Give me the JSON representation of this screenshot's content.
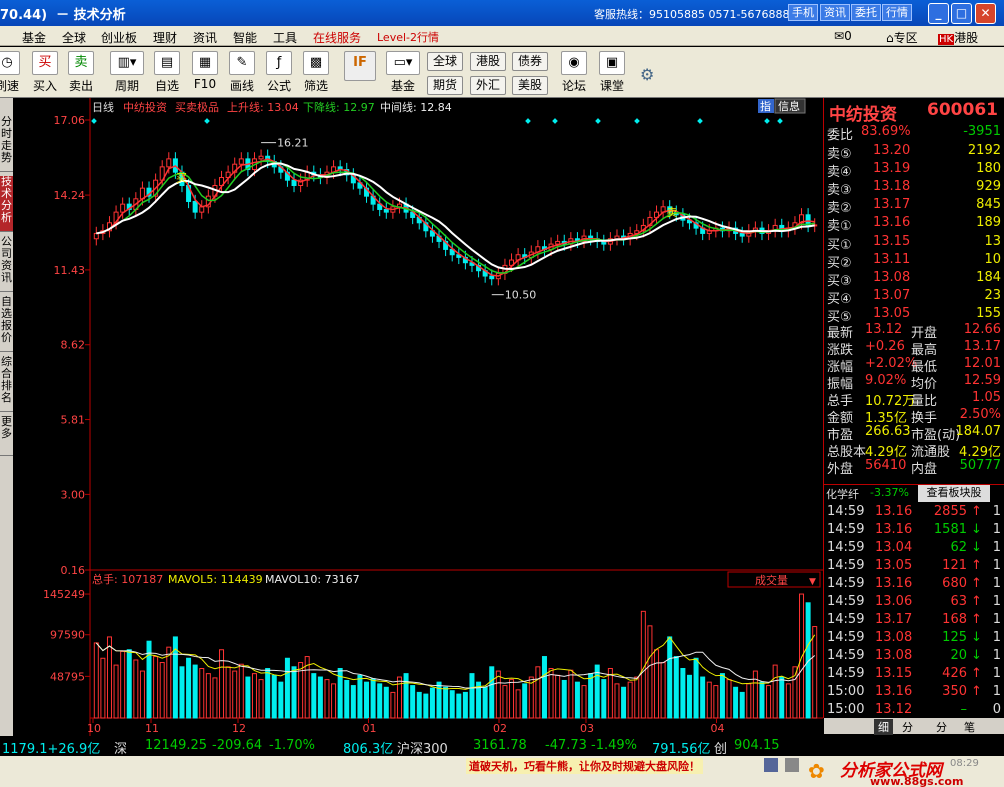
{
  "window": {
    "title": "70.44)  － 技术分析",
    "hotline": "客服热线：95105885  0571-56768888",
    "top_buttons": [
      "手机",
      "资讯",
      "委托",
      "行情"
    ]
  },
  "menu": [
    "基金",
    "全球",
    "创业板",
    "理财",
    "资讯",
    "智能",
    "工具",
    "在线服务",
    "Level-2行情"
  ],
  "menu_right": {
    "mail_count": "0",
    "zone": "专区",
    "hk": "港股"
  },
  "toolbar": {
    "buttons": [
      {
        "label": "刷速",
        "icon": "clock-icon"
      },
      {
        "label": "买入",
        "icon": "buy-icon"
      },
      {
        "label": "卖出",
        "icon": "sell-icon"
      },
      {
        "label": "周期",
        "icon": "period-icon"
      },
      {
        "label": "自选",
        "icon": "watchlist-icon"
      },
      {
        "label": "F10",
        "icon": "f10-icon"
      },
      {
        "label": "画线",
        "icon": "draw-icon"
      },
      {
        "label": "公式",
        "icon": "formula-icon"
      },
      {
        "label": "筛选",
        "icon": "filter-icon"
      },
      {
        "label": "基金",
        "icon": "fund-icon"
      },
      {
        "label": "论坛",
        "icon": "forum-icon"
      },
      {
        "label": "课堂",
        "icon": "class-icon"
      }
    ],
    "small": [
      "全球",
      "港股",
      "债券",
      "期货",
      "外汇",
      "美股"
    ],
    "icon_glyphs": {
      "buy": "买",
      "sell": "卖",
      "if": "IF"
    }
  },
  "left_tabs": [
    "分时走势",
    "技术分析",
    "公司资讯",
    "自选报价",
    "综合排名",
    "更多"
  ],
  "chart_header": {
    "period": "日线",
    "name": "中纺投资",
    "indicator": "买卖极品",
    "upper": "上升线: 13.04",
    "lower": "下降线: 12.97",
    "mid": "中间线: 12.84"
  },
  "chart_overlay": {
    "index_tag": "指",
    "info_tag": "信息",
    "buy_mark": "买",
    "sell_mark": "卖"
  },
  "price_axis": [
    "17.06",
    "14.24",
    "11.43",
    "8.62",
    "5.81",
    "3.00",
    "0.16"
  ],
  "annotations": {
    "high": "16.21",
    "low": "10.50"
  },
  "volume_header": {
    "total": "总手: 107187",
    "ma5": "MAVOL5: 114439",
    "ma10": "MAVOL10: 73167",
    "dropdown": "成交量"
  },
  "volume_axis": [
    "145249",
    "97590",
    "48795"
  ],
  "date_axis": [
    "10",
    "11",
    "12",
    "01",
    "02",
    "03",
    "04"
  ],
  "chart_data": {
    "type": "candlestick",
    "price_ylim": [
      0.16,
      17.06
    ],
    "price_ticks": [
      17.06,
      14.24,
      11.43,
      8.62,
      5.81,
      3.0,
      0.16
    ],
    "high_label": 16.21,
    "low_label": 10.5,
    "closes": [
      12.8,
      12.9,
      13.2,
      13.6,
      13.9,
      13.7,
      14.1,
      14.5,
      14.2,
      14.8,
      15.3,
      15.6,
      15.1,
      14.6,
      14.0,
      13.6,
      13.8,
      14.2,
      14.6,
      14.9,
      15.1,
      15.4,
      15.6,
      15.2,
      15.6,
      15.7,
      15.5,
      15.3,
      15.1,
      14.8,
      14.6,
      14.8,
      15.1,
      15.0,
      14.9,
      15.1,
      15.3,
      15.2,
      15.0,
      14.7,
      14.5,
      14.2,
      13.9,
      13.7,
      13.6,
      13.8,
      13.9,
      13.6,
      13.4,
      13.2,
      12.9,
      12.7,
      12.5,
      12.2,
      12.0,
      11.9,
      11.7,
      11.6,
      11.4,
      11.2,
      11.1,
      11.3,
      11.6,
      11.8,
      12.0,
      11.9,
      12.1,
      12.3,
      12.2,
      12.4,
      12.5,
      12.4,
      12.6,
      12.5,
      12.7,
      12.6,
      12.5,
      12.4,
      12.6,
      12.7,
      12.6,
      12.8,
      12.9,
      13.1,
      13.4,
      13.6,
      13.8,
      13.6,
      13.5,
      13.3,
      13.2,
      13.0,
      12.8,
      12.9,
      13.0,
      12.9,
      13.0,
      12.8,
      12.7,
      12.9,
      13.0,
      12.8,
      12.9,
      13.1,
      12.9,
      13.0,
      13.2,
      13.5,
      13.1,
      13.12
    ],
    "volumes": [
      88000,
      70000,
      95000,
      62000,
      78000,
      80000,
      68000,
      55000,
      90000,
      72000,
      65000,
      83000,
      95000,
      60000,
      70000,
      62000,
      58000,
      52000,
      47000,
      80000,
      60000,
      55000,
      63000,
      48000,
      52000,
      45000,
      58000,
      50000,
      42000,
      70000,
      60000,
      65000,
      72000,
      52000,
      48000,
      45000,
      40000,
      58000,
      44000,
      38000,
      50000,
      42000,
      46000,
      40000,
      36000,
      30000,
      48000,
      52000,
      38000,
      30000,
      28000,
      35000,
      42000,
      36000,
      32000,
      28000,
      30000,
      52000,
      42000,
      36000,
      60000,
      55000,
      38000,
      45000,
      33000,
      40000,
      48000,
      60000,
      72000,
      58000,
      50000,
      44000,
      56000,
      42000,
      38000,
      52000,
      62000,
      45000,
      58000,
      40000,
      36000,
      42000,
      48000,
      125000,
      108000,
      80000,
      65000,
      95000,
      72000,
      58000,
      50000,
      70000,
      48000,
      42000,
      38000,
      52000,
      45000,
      36000,
      30000,
      40000,
      55000,
      42000,
      38000,
      62000,
      48000,
      40000,
      60000,
      145249,
      135000,
      107187
    ],
    "buy_signals_days": [
      13
    ],
    "sell_signals_days": [
      85
    ],
    "volume_ylim": [
      0,
      150000
    ],
    "vol_ticks": [
      145249,
      97590,
      48795
    ],
    "dates": [
      "10",
      "11",
      "12",
      "01",
      "02",
      "03",
      "04"
    ]
  },
  "quote": {
    "title": "中纺投资",
    "code": "600061",
    "ratio": {
      "label": "委比",
      "pct": "83.69%",
      "diff": "-3951"
    },
    "asks": [
      {
        "l": "卖⑤",
        "p": "13.20",
        "v": "2192"
      },
      {
        "l": "卖④",
        "p": "13.19",
        "v": "180"
      },
      {
        "l": "卖③",
        "p": "13.18",
        "v": "929"
      },
      {
        "l": "卖②",
        "p": "13.17",
        "v": "845"
      },
      {
        "l": "卖①",
        "p": "13.16",
        "v": "189"
      }
    ],
    "bids": [
      {
        "l": "买①",
        "p": "13.15",
        "v": "13"
      },
      {
        "l": "买②",
        "p": "13.11",
        "v": "10"
      },
      {
        "l": "买③",
        "p": "13.08",
        "v": "184"
      },
      {
        "l": "买④",
        "p": "13.07",
        "v": "23"
      },
      {
        "l": "买⑤",
        "p": "13.05",
        "v": "155"
      }
    ],
    "stats": [
      {
        "a": "最新",
        "av": "13.12",
        "b": "开盘",
        "bv": "12.66"
      },
      {
        "a": "涨跌",
        "av": "+0.26",
        "b": "最高",
        "bv": "13.17"
      },
      {
        "a": "涨幅",
        "av": "+2.02%",
        "b": "最低",
        "bv": "12.01"
      },
      {
        "a": "振幅",
        "av": "9.02%",
        "b": "均价",
        "bv": "12.59"
      },
      {
        "a": "总手",
        "av": "10.72万",
        "b": "量比",
        "bv": "1.05"
      },
      {
        "a": "金额",
        "av": "1.35亿",
        "b": "换手",
        "bv": "2.50%"
      },
      {
        "a": "市盈",
        "av": "266.63",
        "b": "市盈(动)",
        "bv": "184.07"
      },
      {
        "a": "总股本",
        "av": "4.29亿",
        "b": "流通股",
        "bv": "4.29亿"
      },
      {
        "a": "外盘",
        "av": "56410",
        "b": "内盘",
        "bv": "50777"
      }
    ],
    "sector": {
      "name": "化学纤",
      "pct": "-3.37%",
      "button": "查看板块股"
    },
    "ticks": [
      {
        "t": "14:59",
        "p": "13.16",
        "v": "2855",
        "d": "↑",
        "n": "1"
      },
      {
        "t": "14:59",
        "p": "13.16",
        "v": "1581",
        "d": "↓",
        "n": "1"
      },
      {
        "t": "14:59",
        "p": "13.04",
        "v": "62",
        "d": "↓",
        "n": "1"
      },
      {
        "t": "14:59",
        "p": "13.05",
        "v": "121",
        "d": "↑",
        "n": "1"
      },
      {
        "t": "14:59",
        "p": "13.16",
        "v": "680",
        "d": "↑",
        "n": "1"
      },
      {
        "t": "14:59",
        "p": "13.06",
        "v": "63",
        "d": "↑",
        "n": "1"
      },
      {
        "t": "14:59",
        "p": "13.17",
        "v": "168",
        "d": "↑",
        "n": "1"
      },
      {
        "t": "14:59",
        "p": "13.08",
        "v": "125",
        "d": "↓",
        "n": "1"
      },
      {
        "t": "14:59",
        "p": "13.08",
        "v": "20",
        "d": "↓",
        "n": "1"
      },
      {
        "t": "14:59",
        "p": "13.15",
        "v": "426",
        "d": "↑",
        "n": "1"
      },
      {
        "t": "15:00",
        "p": "13.16",
        "v": "350",
        "d": "↑",
        "n": "1"
      },
      {
        "t": "15:00",
        "p": "13.12",
        "v": "–",
        "d": "",
        "n": "0"
      }
    ],
    "bottom_tabs": [
      "细",
      "分",
      "分",
      "笔"
    ]
  },
  "status": {
    "items": [
      {
        "text": "1179.1+26.9亿",
        "color": "#0ee"
      },
      {
        "text": "深",
        "color": "#ddd"
      },
      {
        "text": "12149.25",
        "color": "#0c0"
      },
      {
        "text": "-209.64",
        "color": "#0c0"
      },
      {
        "text": "-1.70%",
        "color": "#0c0"
      },
      {
        "text": "806.3亿",
        "color": "#0ee"
      },
      {
        "text": "沪深300",
        "color": "#ddd"
      },
      {
        "text": "3161.78",
        "color": "#0c0"
      },
      {
        "text": "-47.73",
        "color": "#0c0"
      },
      {
        "text": "-1.49%",
        "color": "#0c0"
      },
      {
        "text": "791.56亿",
        "color": "#0ee"
      },
      {
        "text": "创",
        "color": "#ddd"
      },
      {
        "text": "904.15",
        "color": "#0c0"
      }
    ]
  },
  "ad": {
    "slogan": "道破天机，巧看牛熊，让你及时规避大盘风险！",
    "logo": "分析家公式网",
    "url": "www.88gs.com",
    "time": "08:29"
  }
}
